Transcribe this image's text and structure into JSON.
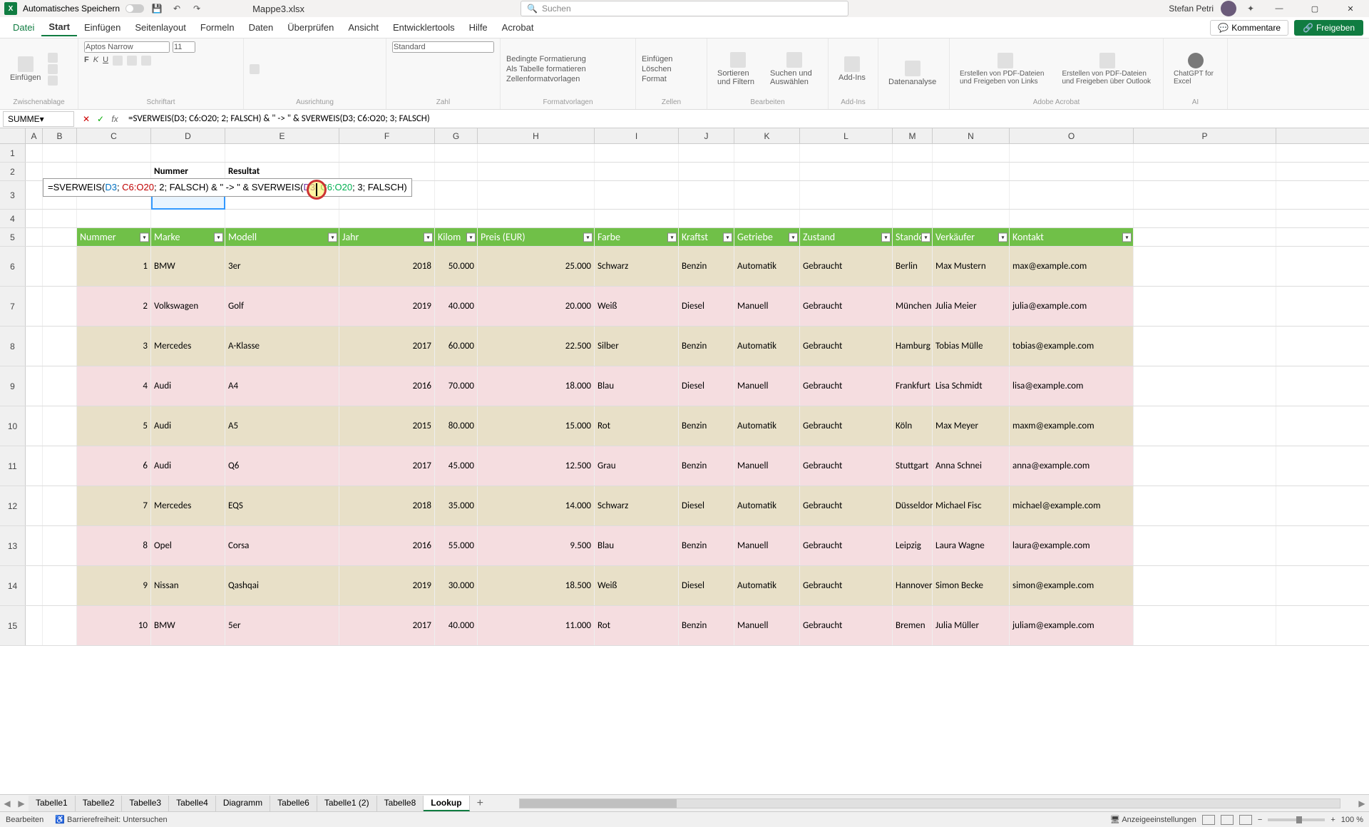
{
  "app": {
    "autosave_label": "Automatisches Speichern",
    "workbook": "Mappe3.xlsx",
    "search_placeholder": "Suchen",
    "user": "Stefan Petri"
  },
  "tabs": {
    "file": "Datei",
    "home": "Start",
    "insert": "Einfügen",
    "page_layout": "Seitenlayout",
    "formulas": "Formeln",
    "data": "Daten",
    "review": "Überprüfen",
    "view": "Ansicht",
    "developer": "Entwicklertools",
    "help": "Hilfe",
    "acrobat": "Acrobat",
    "comments": "Kommentare",
    "share": "Freigeben"
  },
  "ribbon": {
    "paste": "Einfügen",
    "clipboard": "Zwischenablage",
    "font": "Schriftart",
    "font_name": "Aptos Narrow",
    "font_size": "11",
    "alignment": "Ausrichtung",
    "number": "Zahl",
    "number_format": "Standard",
    "cond_format": "Bedingte Formatierung",
    "as_table": "Als Tabelle formatieren",
    "cell_styles": "Zellenformatvorlagen",
    "styles": "Formatvorlagen",
    "insert_cells": "Einfügen",
    "delete_cells": "Löschen",
    "format_cells": "Format",
    "cells": "Zellen",
    "sort_filter": "Sortieren und Filtern",
    "find_select": "Suchen und Auswählen",
    "editing": "Bearbeiten",
    "addins": "Add-Ins",
    "data_analysis": "Datenanalyse",
    "pdf_links": "Erstellen von PDF-Dateien und Freigeben von Links",
    "pdf_outlook": "Erstellen von PDF-Dateien und Freigeben über Outlook",
    "adobe": "Adobe Acrobat",
    "chatgpt": "ChatGPT for Excel",
    "ai": "AI"
  },
  "nameBox": "SUMME",
  "formulaBar": "=SVERWEIS(D3; C6:O20; 2; FALSCH) & \" -> \" & SVERWEIS(D3; C6:O20; 3; FALSCH)",
  "columns": [
    "A",
    "B",
    "C",
    "D",
    "E",
    "F",
    "G",
    "H",
    "I",
    "J",
    "K",
    "L",
    "M",
    "N",
    "O",
    "P"
  ],
  "labels": {
    "nummer": "Nummer",
    "resultat": "Resultat"
  },
  "editFormula": {
    "p1": "=SVERWEIS(",
    "d3a": "D3",
    "sep1": "; ",
    "rng1": "C6:O20",
    "mid1": "; 2; FALSCH) & \" -> \" & SVERWEIS(",
    "d3b": "D3",
    "sep2": "; ",
    "rng2": "C6:O20",
    "end": "; 3; FALSCH)"
  },
  "headers": [
    "Nummer",
    "Marke",
    "Modell",
    "Jahr",
    "Kilom",
    "Preis (EUR)",
    "Farbe",
    "Kraftst",
    "Getriebe",
    "Zustand",
    "Standort",
    "Verkäufer",
    "Kontakt"
  ],
  "rows": [
    {
      "n": "1",
      "marke": "BMW",
      "modell": "3er",
      "jahr": "2018",
      "km": "50.000",
      "preis": "25.000",
      "farbe": "Schwarz",
      "kraft": "Benzin",
      "getr": "Automatik",
      "zust": "Gebraucht",
      "ort": "Berlin",
      "verk": "Max Mustern",
      "kontakt": "max@example.com"
    },
    {
      "n": "2",
      "marke": "Volkswagen",
      "modell": "Golf",
      "jahr": "2019",
      "km": "40.000",
      "preis": "20.000",
      "farbe": "Weiß",
      "kraft": "Diesel",
      "getr": "Manuell",
      "zust": "Gebraucht",
      "ort": "München",
      "verk": "Julia Meier",
      "kontakt": "julia@example.com"
    },
    {
      "n": "3",
      "marke": "Mercedes",
      "modell": "A-Klasse",
      "jahr": "2017",
      "km": "60.000",
      "preis": "22.500",
      "farbe": "Silber",
      "kraft": "Benzin",
      "getr": "Automatik",
      "zust": "Gebraucht",
      "ort": "Hamburg",
      "verk": "Tobias Mülle",
      "kontakt": "tobias@example.com"
    },
    {
      "n": "4",
      "marke": "Audi",
      "modell": "A4",
      "jahr": "2016",
      "km": "70.000",
      "preis": "18.000",
      "farbe": "Blau",
      "kraft": "Diesel",
      "getr": "Manuell",
      "zust": "Gebraucht",
      "ort": "Frankfurt",
      "verk": "Lisa Schmidt",
      "kontakt": "lisa@example.com"
    },
    {
      "n": "5",
      "marke": "Audi",
      "modell": "A5",
      "jahr": "2015",
      "km": "80.000",
      "preis": "15.000",
      "farbe": "Rot",
      "kraft": "Benzin",
      "getr": "Automatik",
      "zust": "Gebraucht",
      "ort": "Köln",
      "verk": "Max Meyer",
      "kontakt": "maxm@example.com"
    },
    {
      "n": "6",
      "marke": "Audi",
      "modell": "Q6",
      "jahr": "2017",
      "km": "45.000",
      "preis": "12.500",
      "farbe": "Grau",
      "kraft": "Benzin",
      "getr": "Manuell",
      "zust": "Gebraucht",
      "ort": "Stuttgart",
      "verk": "Anna Schnei",
      "kontakt": "anna@example.com"
    },
    {
      "n": "7",
      "marke": "Mercedes",
      "modell": "EQS",
      "jahr": "2018",
      "km": "35.000",
      "preis": "14.000",
      "farbe": "Schwarz",
      "kraft": "Diesel",
      "getr": "Automatik",
      "zust": "Gebraucht",
      "ort": "Düsseldorf",
      "verk": "Michael Fisc",
      "kontakt": "michael@example.com"
    },
    {
      "n": "8",
      "marke": "Opel",
      "modell": "Corsa",
      "jahr": "2016",
      "km": "55.000",
      "preis": "9.500",
      "farbe": "Blau",
      "kraft": "Benzin",
      "getr": "Manuell",
      "zust": "Gebraucht",
      "ort": "Leipzig",
      "verk": "Laura Wagne",
      "kontakt": "laura@example.com"
    },
    {
      "n": "9",
      "marke": "Nissan",
      "modell": "Qashqai",
      "jahr": "2019",
      "km": "30.000",
      "preis": "18.500",
      "farbe": "Weiß",
      "kraft": "Diesel",
      "getr": "Automatik",
      "zust": "Gebraucht",
      "ort": "Hannover",
      "verk": "Simon Becke",
      "kontakt": "simon@example.com"
    },
    {
      "n": "10",
      "marke": "BMW",
      "modell": "5er",
      "jahr": "2017",
      "km": "40.000",
      "preis": "11.000",
      "farbe": "Rot",
      "kraft": "Benzin",
      "getr": "Manuell",
      "zust": "Gebraucht",
      "ort": "Bremen",
      "verk": "Julia Müller",
      "kontakt": "juliam@example.com"
    }
  ],
  "sheets": [
    "Tabelle1",
    "Tabelle2",
    "Tabelle3",
    "Tabelle4",
    "Diagramm",
    "Tabelle6",
    "Tabelle1 (2)",
    "Tabelle8",
    "Lookup"
  ],
  "status": {
    "mode": "Bearbeiten",
    "access": "Barrierefreiheit: Untersuchen",
    "display": "Anzeigeeinstellungen",
    "zoom": "100 %"
  }
}
